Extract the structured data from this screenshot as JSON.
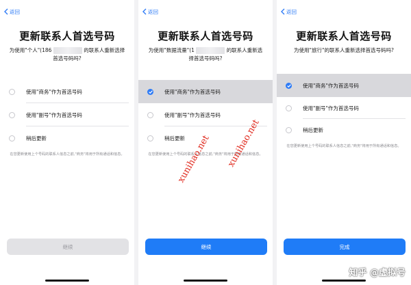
{
  "panels": [
    {
      "back": "返回",
      "title": "更新联系人首选号码",
      "desc_before": "为使用\"个人\"(186",
      "desc_after": "的联系人重新选择首选号码吗?",
      "options": [
        "使用\"商务\"作为首选号码",
        "使用\"副号\"作为首选号码",
        "稍后更新"
      ],
      "selected": -1,
      "footnote": "在您更新使用上个号码的联系人信息之前,\"商务\"将用于所有通话和信息。",
      "button": "继续",
      "button_state": "disabled"
    },
    {
      "back": "返回",
      "title": "更新联系人首选号码",
      "desc_before": "为使用\"数据流量\"(1",
      "desc_after": "的联系人重新选择首选号码吗?",
      "options": [
        "使用\"商务\"作为首选号码",
        "使用\"副号\"作为首选号码",
        "稍后更新"
      ],
      "selected": 0,
      "footnote": "在您更新使用上个号码的联系人信息之前,\"商务\"将用于所有通话和信息。",
      "button": "继续",
      "button_state": "active"
    },
    {
      "back": "返回",
      "title": "更新联系人首选号码",
      "desc_before": "为使用\"旅行\"的联系人重新选择首选号码吗?",
      "desc_after": "",
      "options": [
        "使用\"商务\"作为首选号码",
        "使用\"副号\"作为首选号码",
        "稍后更新"
      ],
      "selected": 0,
      "footnote": "在您更新使用上个号码的联系人信息之前,\"商务\"将用于所有通话和信息。",
      "button": "完成",
      "button_state": "active"
    }
  ],
  "watermark": "xunihao.net",
  "brand": "知乎 @虚拟号",
  "colors": {
    "accent": "#1f7cf7",
    "watermark": "#e0281c"
  }
}
